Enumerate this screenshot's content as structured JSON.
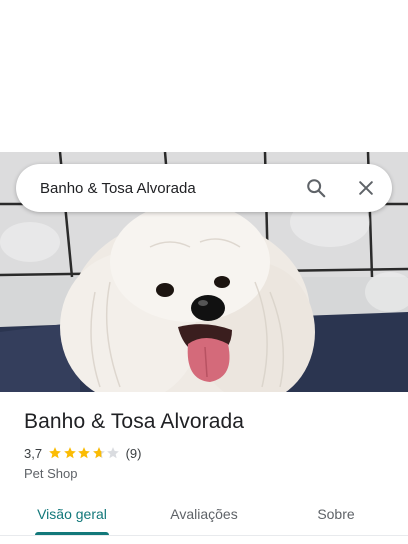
{
  "search": {
    "value": "Banho & Tosa Alvorada",
    "search_icon": "search-icon",
    "close_icon": "close-icon"
  },
  "place": {
    "name": "Banho & Tosa Alvorada",
    "rating": "3,7",
    "rating_value": 3.7,
    "reviews_count": "(9)",
    "category": "Pet Shop"
  },
  "tabs": [
    {
      "label": "Visão geral",
      "active": true
    },
    {
      "label": "Avaliações",
      "active": false
    },
    {
      "label": "Sobre",
      "active": false
    }
  ],
  "colors": {
    "accent": "#12787a",
    "star": "#fbbc04",
    "star_empty": "#dadce0"
  }
}
